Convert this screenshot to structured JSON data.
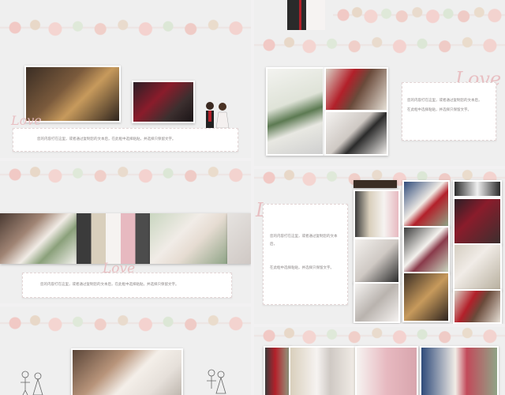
{
  "love_word": "Love",
  "body_line_1": "您的内容打在这里，或者通过复制您的文本后，",
  "body_line_2": "在此框中选择粘贴，并选择只保留文字。",
  "single_line": "您的内容打在这里，或者通过复制您的文本后，在此框中选择粘贴，并选择只保留文字。",
  "colors": {
    "pink_accent": "#e8bfc2",
    "background": "#efefef",
    "text": "#8a8585"
  }
}
